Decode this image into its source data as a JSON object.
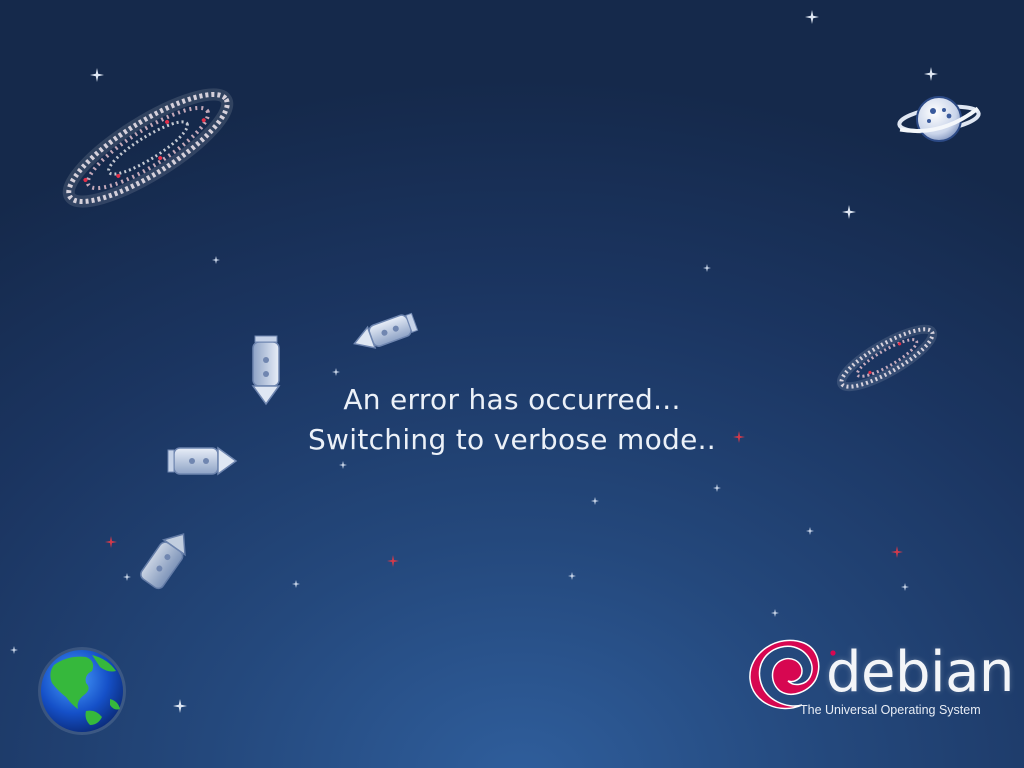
{
  "screen": {
    "title": "Debian boot splash"
  },
  "message": {
    "line1": "An error has occurred...",
    "line2": "Switching to verbose mode.."
  },
  "branding": {
    "wordmark": "debian",
    "tagline": "The Universal Operating System",
    "swirl_color": "#d70751"
  },
  "decorations": {
    "background_theme": "space",
    "icons": [
      "globe-icon",
      "ringed-planet-icon",
      "spiral-galaxy-icon",
      "rocket-icon",
      "star-icon"
    ]
  }
}
